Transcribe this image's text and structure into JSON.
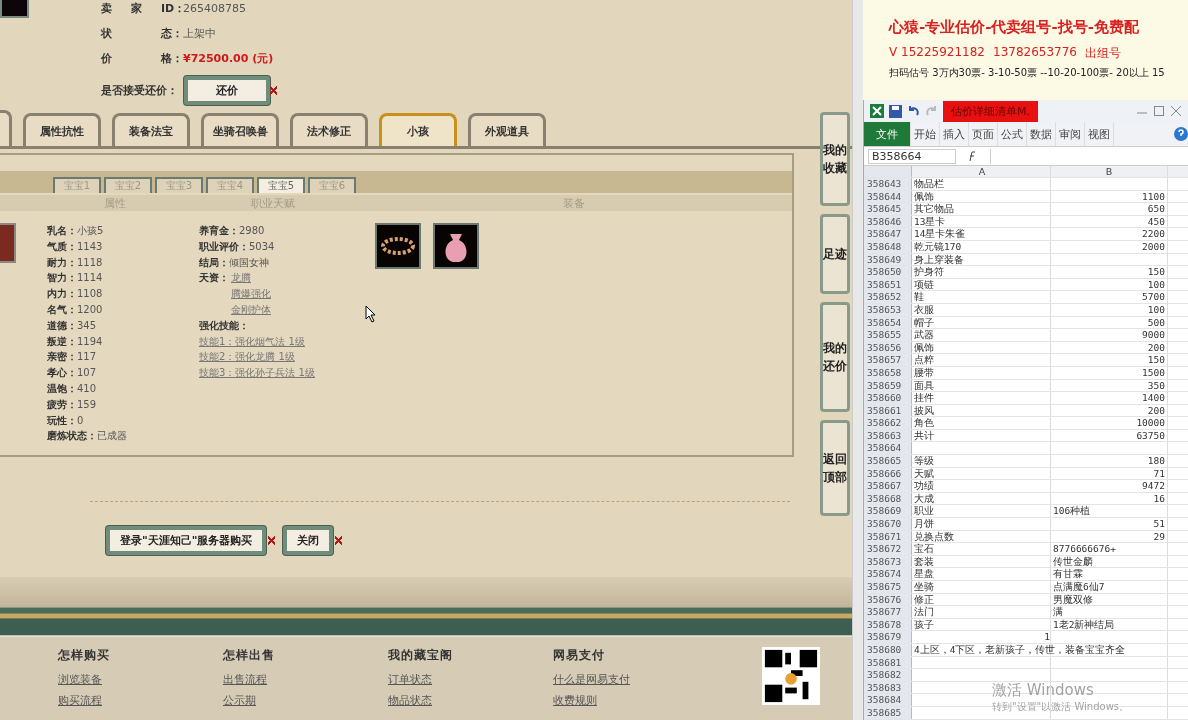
{
  "listing": {
    "rows": [
      {
        "head": "卖",
        "mid": "家",
        "tail": "ID：",
        "value": "265408785",
        "kind": "plain"
      },
      {
        "head": "状",
        "mid": "",
        "tail": "态：",
        "value": "上架中",
        "kind": "plain"
      },
      {
        "head": "价",
        "mid": "",
        "tail": "格：",
        "value": "¥72500.00 (元)",
        "kind": "price"
      }
    ],
    "offer_label": "是否接受还价：",
    "offer_button": "还价"
  },
  "tabs": [
    {
      "label": "属性抗性",
      "selected": false
    },
    {
      "label": "装备法宝",
      "selected": false
    },
    {
      "label": "坐骑召唤兽",
      "selected": false
    },
    {
      "label": "法术修正",
      "selected": false
    },
    {
      "label": "小孩",
      "selected": true
    },
    {
      "label": "外观道具",
      "selected": false
    }
  ],
  "child_tabs": [
    {
      "label": "宝宝1",
      "selected": false
    },
    {
      "label": "宝宝2",
      "selected": false
    },
    {
      "label": "宝宝3",
      "selected": false
    },
    {
      "label": "宝宝4",
      "selected": false
    },
    {
      "label": "宝宝5",
      "selected": true
    },
    {
      "label": "宝宝6",
      "selected": false
    }
  ],
  "columns": [
    "属性",
    "职业天赋",
    "装备"
  ],
  "attributes": [
    {
      "label": "乳名：",
      "value": "小孩5"
    },
    {
      "label": "气质：",
      "value": "1143"
    },
    {
      "label": "耐力：",
      "value": "1118"
    },
    {
      "label": "智力：",
      "value": "1114"
    },
    {
      "label": "内力：",
      "value": "1108"
    },
    {
      "label": "名气：",
      "value": "1200"
    },
    {
      "label": "道德：",
      "value": "345"
    },
    {
      "label": "叛逆：",
      "value": "1194"
    },
    {
      "label": "亲密：",
      "value": "117"
    },
    {
      "label": "孝心：",
      "value": "107"
    },
    {
      "label": "温饱：",
      "value": "410"
    },
    {
      "label": "疲劳：",
      "value": "159"
    },
    {
      "label": "玩性：",
      "value": "0"
    },
    {
      "label": "磨炼状态：",
      "value": "已成器"
    }
  ],
  "career": {
    "items": [
      {
        "label": "养育金：",
        "value": "2980"
      },
      {
        "label": "职业评价：",
        "value": "5034"
      },
      {
        "label": "结局：",
        "value": "倾国女神"
      }
    ],
    "talent_label": "天资：",
    "talents": [
      "龙腾",
      "腾爆强化",
      "金刚护体"
    ],
    "skills_label": "强化技能：",
    "skills": [
      "技能1：强化烟气法 1级",
      "技能2：强化龙腾 1级",
      "技能3：强化孙子兵法 1级"
    ]
  },
  "buttons": [
    "登录\"天涯知己\"服务器购买",
    "关闭"
  ],
  "side_nav": [
    "我的收藏",
    "足迹",
    "我的还价",
    "返回顶部"
  ],
  "footer": [
    {
      "title": "怎样购买",
      "links": [
        "浏览装备",
        "购买流程"
      ]
    },
    {
      "title": "怎样出售",
      "links": [
        "出售流程",
        "公示期"
      ]
    },
    {
      "title": "我的藏宝阁",
      "links": [
        "订单状态",
        "物品状态"
      ]
    },
    {
      "title": "网易支付",
      "links": [
        "什么是网易支付",
        "收费规则"
      ]
    }
  ],
  "ad": {
    "title": "心猿-专业估价-代卖组号-找号-免费配",
    "phone": "V 15225921182",
    "phone2": "13782653776",
    "line2_end": "出组号",
    "line3": "扫码估号 3万内30票- 3-10-50票  --10-20-100票- 20以上 15"
  },
  "spreadsheet": {
    "title_button": "估价详细清单M.",
    "ribbon_tabs": [
      {
        "label": "文件",
        "selected": true
      },
      {
        "label": "开始",
        "selected": false
      },
      {
        "label": "插入",
        "selected": false
      },
      {
        "label": "页面",
        "selected": false
      },
      {
        "label": "公式",
        "selected": false
      },
      {
        "label": "数据",
        "selected": false
      },
      {
        "label": "审阅",
        "selected": false
      },
      {
        "label": "视图",
        "selected": false
      }
    ],
    "name_box": "B358664",
    "columns": [
      "A",
      "B"
    ],
    "rows": [
      {
        "n": "358643",
        "a": "物品栏",
        "b": "",
        "kind": "number"
      },
      {
        "n": "358644",
        "a": "佩饰",
        "b": "1100",
        "kind": "number"
      },
      {
        "n": "358645",
        "a": "其它物品",
        "b": "650",
        "kind": "number"
      },
      {
        "n": "358646",
        "a": "13星卡",
        "b": "450",
        "kind": "number"
      },
      {
        "n": "358647",
        "a": "14星卡朱雀",
        "b": "2200",
        "kind": "number"
      },
      {
        "n": "358648",
        "a": "乾元镜170",
        "b": "2000",
        "kind": "number"
      },
      {
        "n": "358649",
        "a": "身上穿装备",
        "b": "",
        "kind": "number"
      },
      {
        "n": "358650",
        "a": "护身符",
        "b": "150",
        "kind": "number"
      },
      {
        "n": "358651",
        "a": "项链",
        "b": "100",
        "kind": "number"
      },
      {
        "n": "358652",
        "a": "鞋",
        "b": "5700",
        "kind": "number"
      },
      {
        "n": "358653",
        "a": "衣服",
        "b": "100",
        "kind": "number"
      },
      {
        "n": "358654",
        "a": "帽子",
        "b": "500",
        "kind": "number"
      },
      {
        "n": "358655",
        "a": "武器",
        "b": "9000",
        "kind": "number"
      },
      {
        "n": "358656",
        "a": "佩饰",
        "b": "200",
        "kind": "number"
      },
      {
        "n": "358657",
        "a": "点粹",
        "b": "150",
        "kind": "number"
      },
      {
        "n": "358658",
        "a": "腰带",
        "b": "1500",
        "kind": "number"
      },
      {
        "n": "358659",
        "a": "面具",
        "b": "350",
        "kind": "number"
      },
      {
        "n": "358660",
        "a": "挂件",
        "b": "1400",
        "kind": "number"
      },
      {
        "n": "358661",
        "a": "披风",
        "b": "200",
        "kind": "number"
      },
      {
        "n": "358662",
        "a": "角色",
        "b": "10000",
        "kind": "number"
      },
      {
        "n": "358663",
        "a": "共计",
        "b": "63750",
        "kind": "number"
      },
      {
        "n": "358664",
        "a": "",
        "b": "",
        "kind": "number"
      },
      {
        "n": "358665",
        "a": "等级",
        "b": "180",
        "kind": "number"
      },
      {
        "n": "358666",
        "a": "天赋",
        "b": "71",
        "kind": "number"
      },
      {
        "n": "358667",
        "a": "功绩",
        "b": "9472",
        "kind": "number"
      },
      {
        "n": "358668",
        "a": "大成",
        "b": "16",
        "kind": "number"
      },
      {
        "n": "358669",
        "a": "职业",
        "b": "106种植",
        "kind": "text"
      },
      {
        "n": "358670",
        "a": "月饼",
        "b": "51",
        "kind": "number"
      },
      {
        "n": "358671",
        "a": "兑换点数",
        "b": "29",
        "kind": "number"
      },
      {
        "n": "358672",
        "a": "宝石",
        "b": "8776666676+",
        "kind": "text"
      },
      {
        "n": "358673",
        "a": "套装",
        "b": "传世金麟",
        "kind": "text"
      },
      {
        "n": "358674",
        "a": "星盘",
        "b": "有甘霖",
        "kind": "text"
      },
      {
        "n": "358675",
        "a": "坐骑",
        "b": "点满魔6仙7",
        "kind": "text"
      },
      {
        "n": "358676",
        "a": "修正",
        "b": "男魔双修",
        "kind": "text"
      },
      {
        "n": "358677",
        "a": "法门",
        "b": "满",
        "kind": "text"
      },
      {
        "n": "358678",
        "a": "孩子",
        "b": "1老2新神结局",
        "kind": "text"
      },
      {
        "n": "358679",
        "a": "1",
        "b": "",
        "kind": "a-number"
      },
      {
        "n": "358680",
        "a": "4上区，4下区，老新孩子，传世，装备宝宝齐全",
        "b": "",
        "kind": "text"
      },
      {
        "n": "358681",
        "a": "",
        "b": "",
        "kind": "number"
      },
      {
        "n": "358682",
        "a": "",
        "b": "",
        "kind": "number"
      },
      {
        "n": "358683",
        "a": "",
        "b": "",
        "kind": "number"
      },
      {
        "n": "358684",
        "a": "",
        "b": "",
        "kind": "number"
      },
      {
        "n": "358685",
        "a": "",
        "b": "",
        "kind": "number"
      }
    ]
  },
  "os_notice": {
    "title": "激活 Windows",
    "text": "转到\"设置\"以激活 Windows。"
  }
}
